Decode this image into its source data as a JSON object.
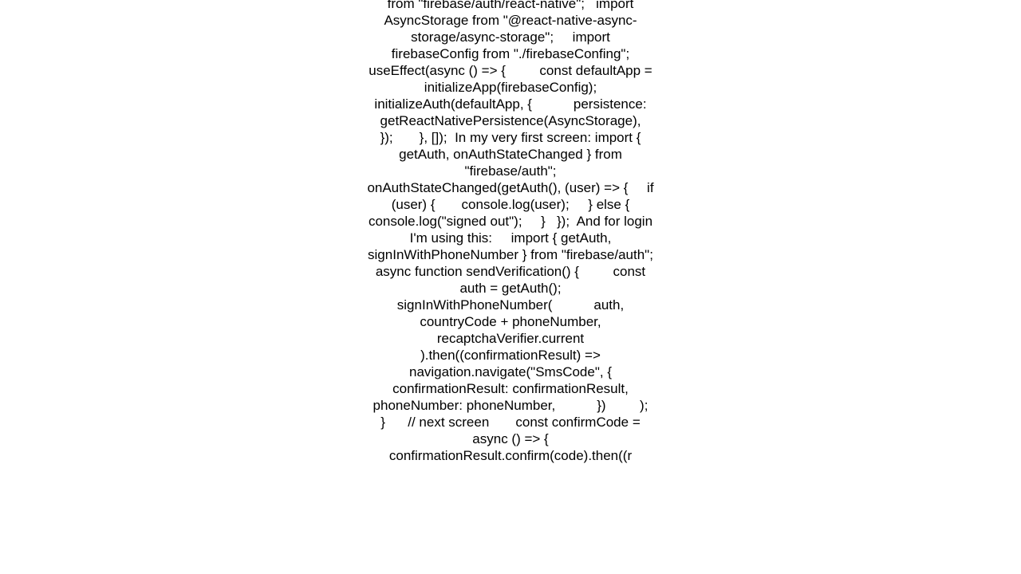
{
  "document": {
    "body_text": "from \"firebase/auth/react-native\";   import AsyncStorage from \"@react-native-async-storage/async-storage\";     import firebaseConfig from \"./firebaseConfing\";       useEffect(async () => {         const defaultApp = initializeApp(firebaseConfig);         initializeAuth(defaultApp, {           persistence: getReactNativePersistence(AsyncStorage),         });       }, []);  In my very first screen: import { getAuth, onAuthStateChanged } from \"firebase/auth\";   onAuthStateChanged(getAuth(), (user) => {     if (user) {       console.log(user);     } else {       console.log(\"signed out\");     }   });  And for login I'm using this:     import { getAuth, signInWithPhoneNumber } from \"firebase/auth\";          async function sendVerification() {         const auth = getAuth();         signInWithPhoneNumber(           auth,           countryCode + phoneNumber,           recaptchaVerifier.current         ).then((confirmationResult) =>           navigation.navigate(\"SmsCode\", {             confirmationResult: confirmationResult,             phoneNumber: phoneNumber,           })         );       }      // next screen       const confirmCode = async () => {         confirmationResult.confirm(code).then((r"
  }
}
